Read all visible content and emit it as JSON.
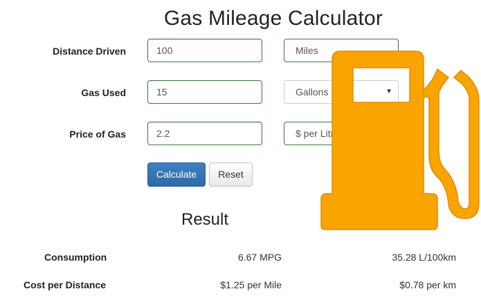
{
  "title": "Gas Mileage Calculator",
  "form": {
    "distance": {
      "label": "Distance Driven",
      "value": "100",
      "unit": "Miles"
    },
    "gas": {
      "label": "Gas Used",
      "value": "15",
      "unit": "Gallons"
    },
    "price": {
      "label": "Price of Gas",
      "value": "2.2",
      "unit": "$ per Litre"
    }
  },
  "buttons": {
    "calculate": "Calculate",
    "reset": "Reset"
  },
  "result": {
    "title": "Result",
    "consumption": {
      "label": "Consumption",
      "mpg": "6.67 MPG",
      "metric": "35.28 L/100km"
    },
    "cost": {
      "label": "Cost per Distance",
      "per_mile": "$1.25 per Mile",
      "per_km": "$0.78 per km"
    }
  },
  "colors": {
    "pump": "#F9A400",
    "primary": "#337AB7",
    "field_border": "#3C763D"
  },
  "icons": {
    "overlay": "gas-pump-icon",
    "select_arrow": "caret-down-icon"
  }
}
